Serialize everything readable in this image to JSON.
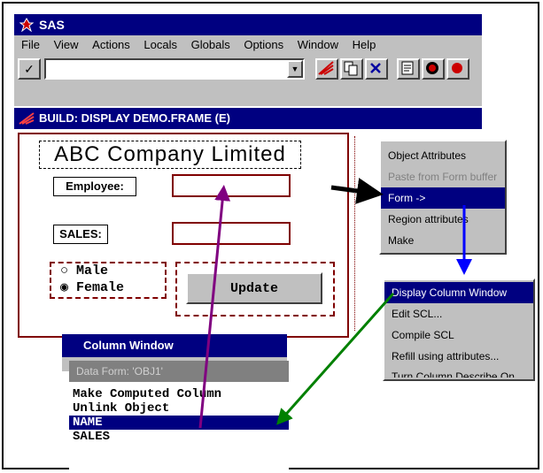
{
  "app": {
    "title": "SAS"
  },
  "menubar": {
    "items": [
      "File",
      "View",
      "Actions",
      "Locals",
      "Globals",
      "Options",
      "Window",
      "Help"
    ]
  },
  "toolbar": {
    "check_label": "✓",
    "combo_value": "",
    "dropdown_arrow": "▼"
  },
  "build_window": {
    "title": "BUILD: DISPLAY DEMO.FRAME (E)"
  },
  "form": {
    "company": "ABC Company Limited",
    "employee_label": "Employee:",
    "sales_label": "SALES:",
    "radio": {
      "male": "Male",
      "female": "Female",
      "selected": "Female"
    },
    "update_label": "Update"
  },
  "popup_menu_1": {
    "items": [
      "Object Attributes",
      "Paste from Form buffer",
      "Form ->",
      "Region attributes",
      "Make"
    ],
    "selected": "Form ->"
  },
  "popup_menu_2": {
    "items": [
      "Display Column Window",
      "Edit SCL...",
      "Compile SCL",
      "Refill using attributes...",
      "Turn Column Describe On"
    ],
    "selected": "Display Column Window"
  },
  "column_window": {
    "title": "Column Window",
    "header": "Data Form: 'OBJ1'",
    "items": [
      "Make Computed Column",
      "Unlink Object",
      "NAME",
      "SALES"
    ],
    "selected": "NAME"
  },
  "colors": {
    "title_bar": "#000080",
    "arrow_purple": "#800080",
    "arrow_blue": "#0000ff",
    "arrow_green": "#008000",
    "form_border": "#800000"
  }
}
